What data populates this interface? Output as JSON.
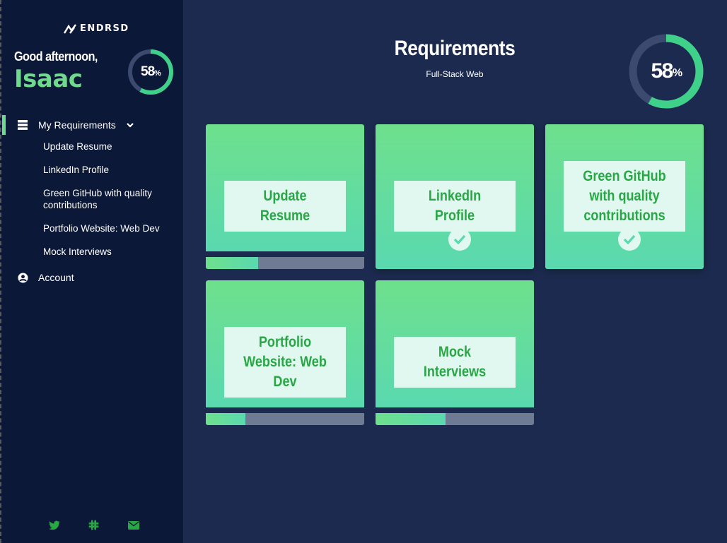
{
  "brand": {
    "name": "ENDRSD"
  },
  "sidebar": {
    "greeting": "Good afternoon,",
    "username": "Isaac",
    "progress": {
      "value": 58,
      "number": "58",
      "unit": "%"
    },
    "nav": {
      "my_requirements": "My Requirements",
      "sub_items": [
        "Update Resume",
        "LinkedIn Profile",
        "Green GitHub with quality contributions",
        "Portfolio Website: Web Dev",
        "Mock Interviews"
      ],
      "account": "Account"
    },
    "social_icons": [
      "twitter-icon",
      "slack-icon",
      "mail-icon"
    ]
  },
  "main": {
    "title": "Requirements",
    "subtitle": "Full-Stack Web",
    "progress": {
      "value": 58,
      "number": "58",
      "unit": "%"
    },
    "cards": [
      {
        "label": "Update Resume",
        "completed": false,
        "progress": 0.33
      },
      {
        "label": "LinkedIn Profile",
        "completed": true
      },
      {
        "label": "Green GitHub with quality contributions",
        "completed": true
      },
      {
        "label": "Portfolio Website: Web Dev",
        "completed": false,
        "progress": 0.25
      },
      {
        "label": "Mock Interviews",
        "completed": false,
        "progress": 0.44
      }
    ]
  },
  "colors": {
    "accent": "#6fd98c",
    "sidebar_bg": "#0c1838",
    "main_bg": "#1b2a4e",
    "card_text": "#28a745",
    "track": "#6f7a93"
  }
}
